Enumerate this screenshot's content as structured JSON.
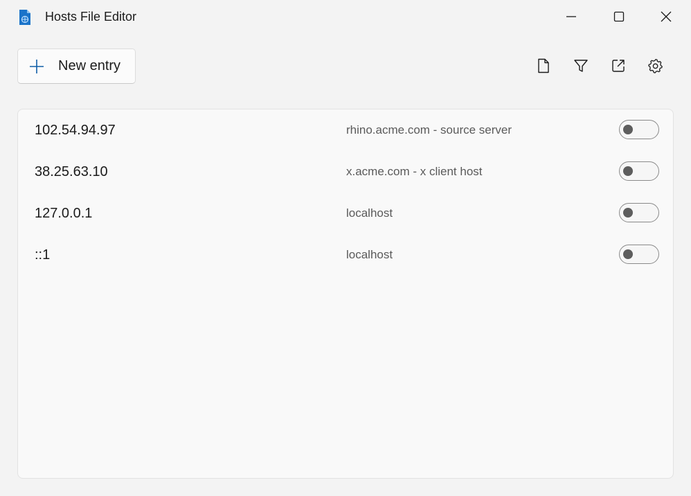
{
  "window": {
    "title": "Hosts File Editor",
    "accent_color": "#0067c0"
  },
  "toolbar": {
    "new_entry_label": "New entry",
    "icons": [
      "file-icon",
      "filter-icon",
      "open-external-icon",
      "settings-icon"
    ]
  },
  "entries": [
    {
      "address": "102.54.94.97",
      "hosts": "rhino.acme.com - source server",
      "active": false
    },
    {
      "address": "38.25.63.10",
      "hosts": "x.acme.com - x client host",
      "active": false
    },
    {
      "address": "127.0.0.1",
      "hosts": "localhost",
      "active": false
    },
    {
      "address": "::1",
      "hosts": "localhost",
      "active": false
    }
  ]
}
